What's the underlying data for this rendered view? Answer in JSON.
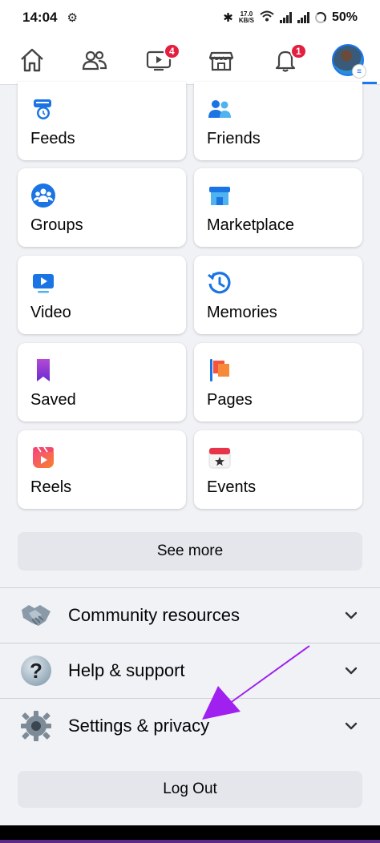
{
  "status_bar": {
    "time": "14:04",
    "speed_top": "17.0",
    "speed_bottom": "KB/S",
    "battery": "50%"
  },
  "nav": {
    "items": [
      {
        "name": "home",
        "icon": "home-icon"
      },
      {
        "name": "friends",
        "icon": "friends-icon"
      },
      {
        "name": "video",
        "icon": "video-icon",
        "badge": "4"
      },
      {
        "name": "marketplace",
        "icon": "marketplace-icon"
      },
      {
        "name": "notifications",
        "icon": "bell-icon",
        "badge": "1"
      },
      {
        "name": "menu",
        "icon": "avatar"
      }
    ],
    "active_color": "#1877f2",
    "badge_color": "#e41e3f"
  },
  "shortcuts": [
    {
      "label": "Feeds",
      "icon": "feeds-icon"
    },
    {
      "label": "Friends",
      "icon": "friends-icon"
    },
    {
      "label": "Groups",
      "icon": "groups-icon"
    },
    {
      "label": "Marketplace",
      "icon": "marketplace-icon"
    },
    {
      "label": "Video",
      "icon": "video-icon"
    },
    {
      "label": "Memories",
      "icon": "memories-icon"
    },
    {
      "label": "Saved",
      "icon": "bookmark-icon"
    },
    {
      "label": "Pages",
      "icon": "flag-icon"
    },
    {
      "label": "Reels",
      "icon": "reels-icon"
    },
    {
      "label": "Events",
      "icon": "calendar-icon"
    }
  ],
  "see_more_label": "See more",
  "sections": [
    {
      "label": "Community resources",
      "icon": "handshake-icon"
    },
    {
      "label": "Help & support",
      "icon": "question-icon"
    },
    {
      "label": "Settings & privacy",
      "icon": "gear-icon"
    }
  ],
  "logout_label": "Log Out",
  "annotation_color": "#a020f0"
}
